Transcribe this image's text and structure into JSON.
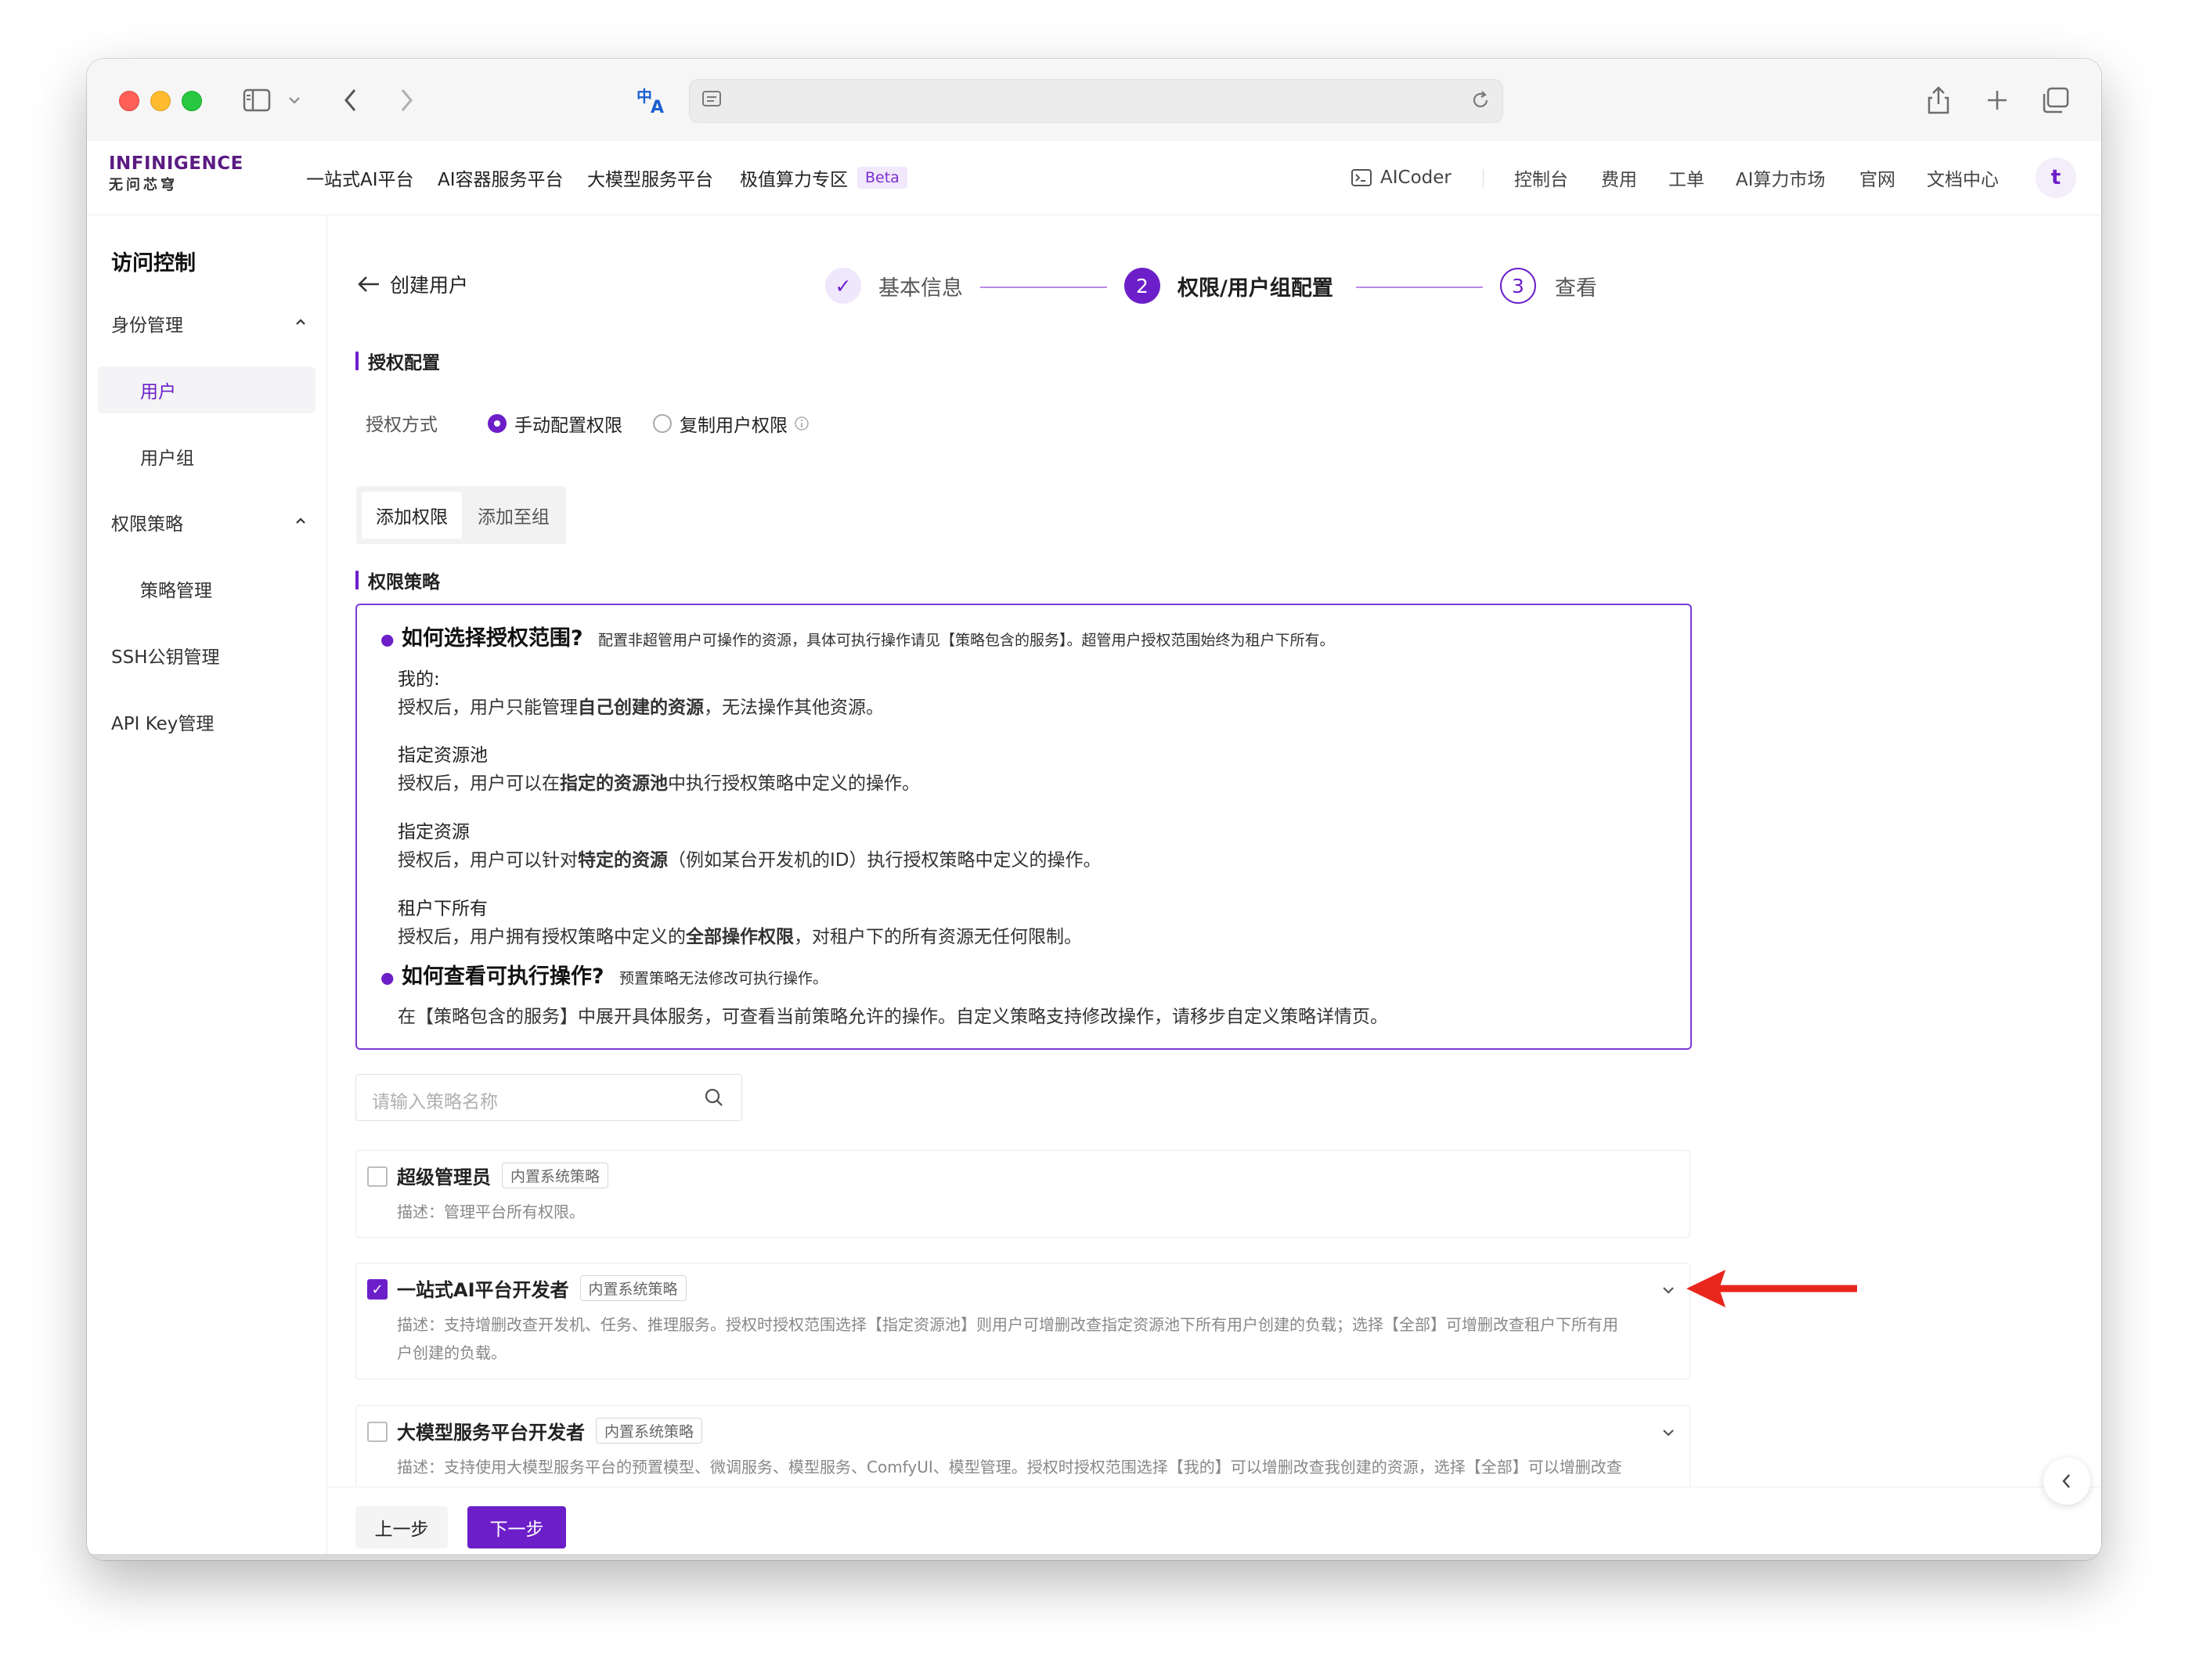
{
  "browser": {
    "translate_icon": "translate-icon",
    "sidebar_toggle_icon": "sidebar-toggle-icon"
  },
  "nav": {
    "logo_top": "INFINIGENCE",
    "logo_bottom": "无问芯穹",
    "items": [
      "一站式AI平台",
      "AI容器服务平台",
      "大模型服务平台",
      "极值算力专区"
    ],
    "beta": "Beta",
    "right_items": [
      "AICoder",
      "控制台",
      "费用",
      "工单",
      "AI算力市场",
      "官网",
      "文档中心"
    ],
    "avatar": "t"
  },
  "sidebar": {
    "title": "访问控制",
    "groups": [
      {
        "label": "身份管理",
        "items": [
          "用户",
          "用户组"
        ]
      },
      {
        "label": "权限策略",
        "items": [
          "策略管理"
        ]
      }
    ],
    "ssh": "SSH公钥管理",
    "apikey": "API Key管理",
    "active": "用户"
  },
  "page": {
    "back_title": "创建用户",
    "steps": [
      {
        "num": "✓",
        "label": "基本信息",
        "state": "done"
      },
      {
        "num": "2",
        "label": "权限/用户组配置",
        "state": "active"
      },
      {
        "num": "3",
        "label": "查看",
        "state": "pending"
      }
    ],
    "auth_section": "授权配置",
    "auth_method_label": "授权方式",
    "auth_options": [
      "手动配置权限",
      "复制用户权限"
    ],
    "tabs": [
      "添加权限",
      "添加至组"
    ],
    "policy_section": "权限策略"
  },
  "info": {
    "q1_title": "如何选择授权范围?",
    "q1_desc": "配置非超管用户可操作的资源，具体可执行操作请见【策略包含的服务】。超管用户授权范围始终为租户下所有。",
    "scopes": [
      {
        "name": "我的:",
        "pre": "授权后，用户只能管理",
        "bold": "自己创建的资源",
        "post": "，无法操作其他资源。"
      },
      {
        "name": "指定资源池",
        "pre": "授权后，用户可以在",
        "bold": "指定的资源池",
        "post": "中执行授权策略中定义的操作。"
      },
      {
        "name": "指定资源",
        "pre": "授权后，用户可以针对",
        "bold": "特定的资源",
        "post": "（例如某台开发机的ID）执行授权策略中定义的操作。"
      },
      {
        "name": "租户下所有",
        "pre": "授权后，用户拥有授权策略中定义的",
        "bold": "全部操作权限",
        "post": "，对租户下的所有资源无任何限制。"
      }
    ],
    "q2_title": "如何查看可执行操作?",
    "q2_desc": "预置策略无法修改可执行操作。",
    "q2_body": "在【策略包含的服务】中展开具体服务，可查看当前策略允许的操作。自定义策略支持修改操作，请移步自定义策略详情页。"
  },
  "search": {
    "placeholder": "请输入策略名称"
  },
  "policies": [
    {
      "name": "超级管理员",
      "tag": "内置系统策略",
      "checked": false,
      "desc1": "描述：管理平台所有权限。",
      "desc2": ""
    },
    {
      "name": "一站式AI平台开发者",
      "tag": "内置系统策略",
      "checked": true,
      "desc1": "描述：支持增删改查开发机、任务、推理服务。授权时授权范围选择【指定资源池】则用户可增删改查指定资源池下所有用户创建的负载；选择【全部】可增删改查租户下所有用",
      "desc2": "户创建的负载。"
    },
    {
      "name": "大模型服务平台开发者",
      "tag": "内置系统策略",
      "checked": false,
      "desc1": "描述：支持使用大模型服务平台的预置模型、微调服务、模型服务、ComfyUI、模型管理。授权时授权范围选择【我的】可以增删改查我创建的资源，选择【全部】可以增删改查",
      "desc2": ""
    }
  ],
  "footer": {
    "prev": "上一步",
    "next": "下一步"
  },
  "colors": {
    "accent": "#6c1fc9",
    "annotation_arrow": "#e8261c"
  }
}
